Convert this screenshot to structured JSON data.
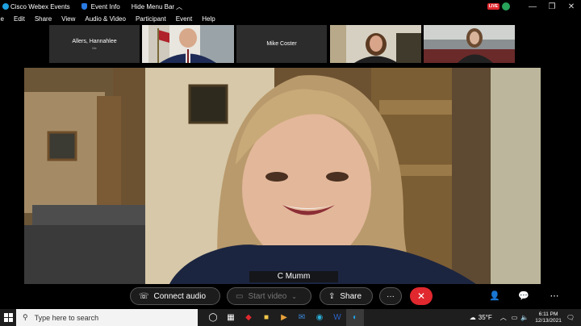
{
  "titlebar": {
    "app_title": "Cisco Webex Events",
    "event_info": "Event Info",
    "hide_menu": "Hide Menu Bar",
    "live_badge": "LIVE"
  },
  "menu": [
    "ile",
    "Edit",
    "Share",
    "View",
    "Audio & Video",
    "Participant",
    "Event",
    "Help"
  ],
  "participants": [
    {
      "name": "Allers, Hannahlee",
      "sub": "Me"
    },
    {
      "name": ""
    },
    {
      "name": "Mike Coster"
    },
    {
      "name": ""
    },
    {
      "name": ""
    }
  ],
  "main_video": {
    "name": "C Mumm"
  },
  "controls": {
    "connect_audio": "Connect audio",
    "start_video": "Start video",
    "share": "Share",
    "more": "···",
    "end": "✕"
  },
  "taskbar": {
    "search_placeholder": "Type here to search",
    "weather": "35°F",
    "time": "6:11 PM",
    "date": "12/13/2021"
  },
  "colors": {
    "end_red": "#e0282e",
    "webex_blue": "#1fa0e0",
    "tray_green": "#27a35a"
  }
}
